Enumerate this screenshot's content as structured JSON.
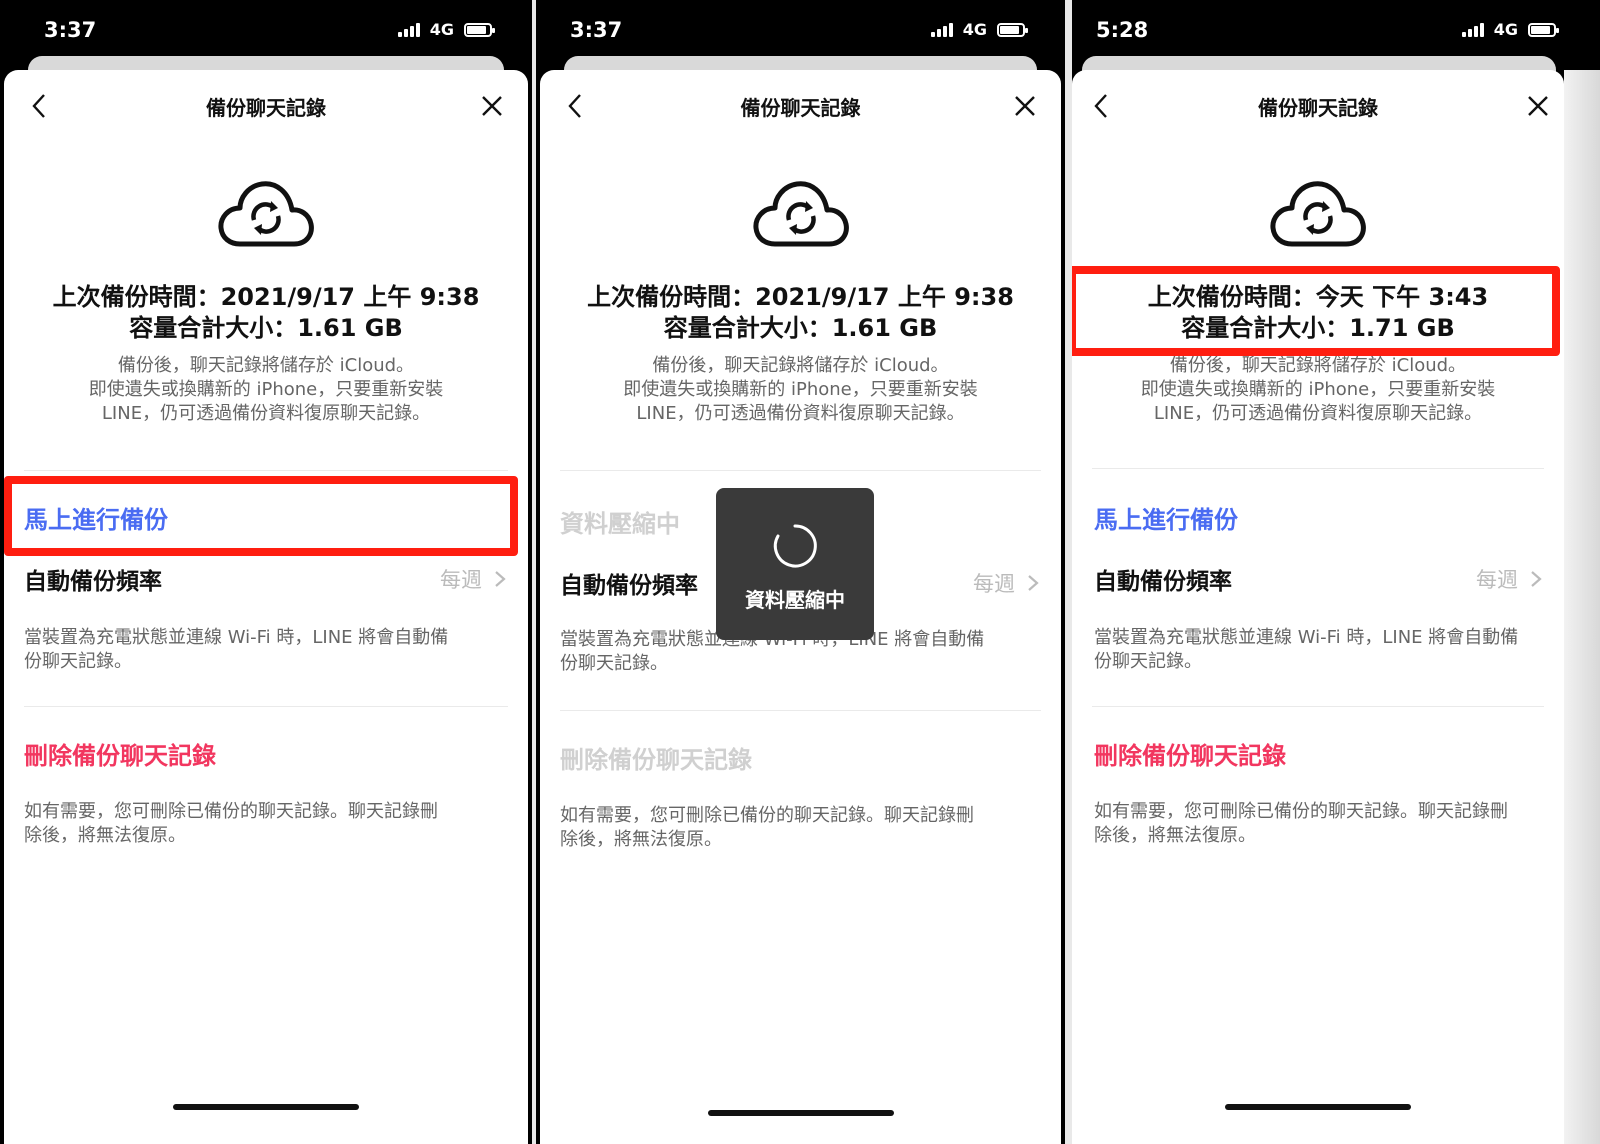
{
  "screens": [
    {
      "status_time": "3:37",
      "network": "4G",
      "title": "備份聊天記錄",
      "last_backup_line": "上次備份時間：2021/9/17 上午 9:38",
      "size_line": "容量合計大小：1.61 GB",
      "description": [
        "備份後，聊天記錄將儲存於 iCloud。",
        "即使遺失或換購新的 iPhone，只要重新安裝",
        "LINE，仍可透過備份資料復原聊天記錄。"
      ],
      "backup_now_label": "馬上進行備份",
      "auto_backup_label": "自動備份頻率",
      "auto_backup_value": "每週",
      "auto_backup_note": [
        "當裝置為充電狀態並連線 Wi-Fi 時，LINE 將會自動備",
        "份聊天記錄。"
      ],
      "delete_label": "刪除備份聊天記錄",
      "delete_note": [
        "如有需要，您可刪除已備份的聊天記錄。聊天記錄刪",
        "除後，將無法復原。"
      ]
    },
    {
      "status_time": "3:37",
      "network": "4G",
      "title": "備份聊天記錄",
      "last_backup_line": "上次備份時間：2021/9/17 上午 9:38",
      "size_line": "容量合計大小：1.61 GB",
      "description": [
        "備份後，聊天記錄將儲存於 iCloud。",
        "即使遺失或換購新的 iPhone，只要重新安裝",
        "LINE，仍可透過備份資料復原聊天記錄。"
      ],
      "backup_now_label": "資料壓縮中",
      "auto_backup_label": "自動備份頻率",
      "auto_backup_value": "每週",
      "auto_backup_note": [
        "當裝置為充電狀態並連線 Wi-Fi 時，LINE 將會自動備",
        "份聊天記錄。"
      ],
      "delete_label": "刪除備份聊天記錄",
      "delete_note": [
        "如有需要，您可刪除已備份的聊天記錄。聊天記錄刪",
        "除後，將無法復原。"
      ],
      "toast_text": "資料壓縮中"
    },
    {
      "status_time": "5:28",
      "network": "4G",
      "title": "備份聊天記錄",
      "last_backup_line": "上次備份時間：今天 下午 3:43",
      "size_line": "容量合計大小：1.71 GB",
      "description": [
        "備份後，聊天記錄將儲存於 iCloud。",
        "即使遺失或換購新的 iPhone，只要重新安裝",
        "LINE，仍可透過備份資料復原聊天記錄。"
      ],
      "backup_now_label": "馬上進行備份",
      "auto_backup_label": "自動備份頻率",
      "auto_backup_value": "每週",
      "auto_backup_note": [
        "當裝置為充電狀態並連線 Wi-Fi 時，LINE 將會自動備",
        "份聊天記錄。"
      ],
      "delete_label": "刪除備份聊天記錄",
      "delete_note": [
        "如有需要，您可刪除已備份的聊天記錄。聊天記錄刪",
        "除後，將無法復原。"
      ]
    }
  ],
  "colors": {
    "link_blue": "#4a6cf2",
    "delete_red": "#f2365f",
    "disabled_gray": "#d0d0d0",
    "highlight_red": "#ff1e10"
  }
}
